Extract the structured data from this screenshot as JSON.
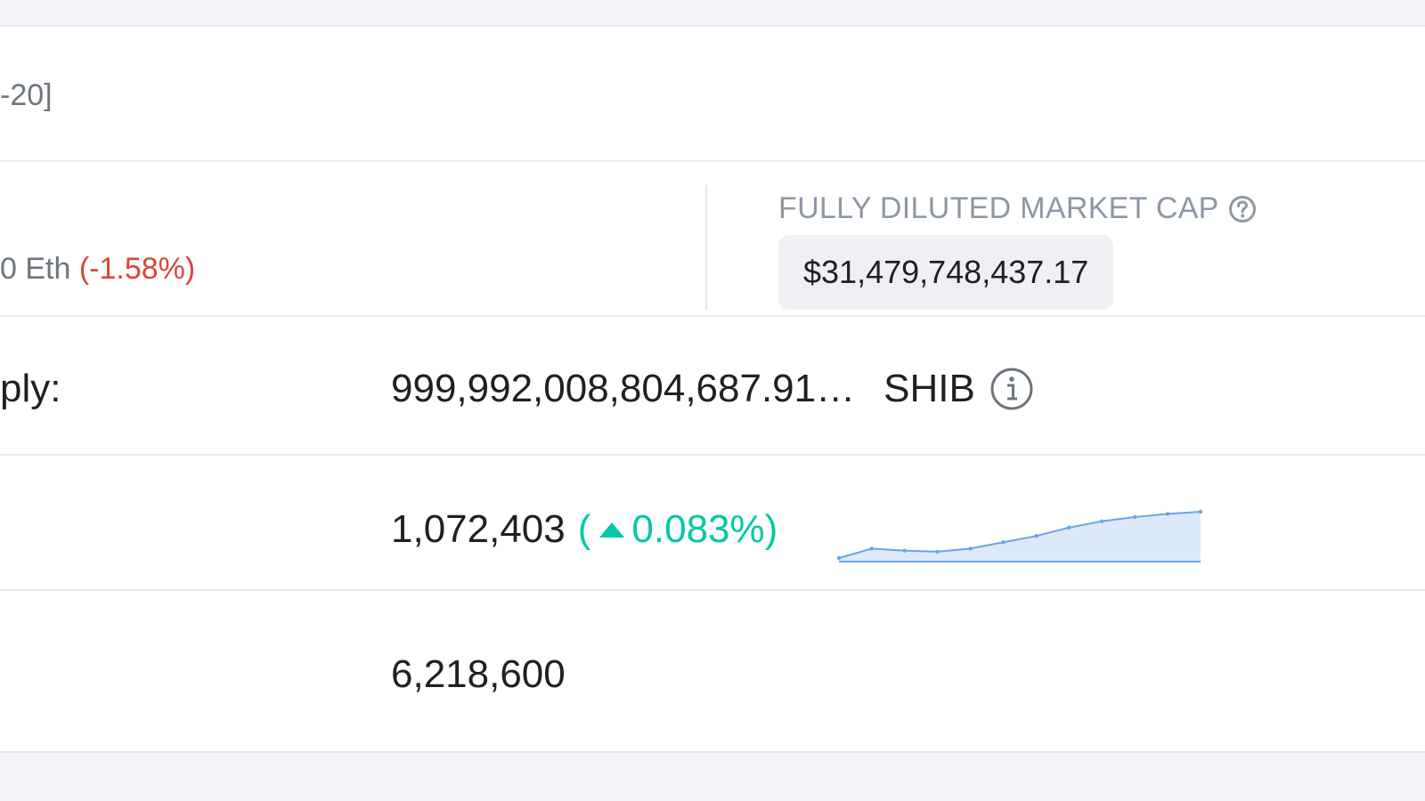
{
  "token_type": "-20]",
  "price_eth": {
    "value": "0 Eth",
    "change": "(-1.58%)"
  },
  "fully_diluted": {
    "label": "FULLY DILUTED MARKET CAP",
    "value": "$31,479,748,437.17",
    "help_icon": "question-circle-icon"
  },
  "supply": {
    "label": "ply:",
    "value": "999,992,008,804,687.91…",
    "symbol": "SHIB",
    "info_icon": "info-circle-icon"
  },
  "holders": {
    "value": "1,072,403",
    "change_open": "(",
    "change_value": "0.083%)",
    "trend_icon": "caret-up-icon",
    "sparkline": [
      1068000,
      1068900,
      1068700,
      1068600,
      1068900,
      1069500,
      1070100,
      1070900,
      1071500,
      1071900,
      1072200,
      1072403
    ]
  },
  "transfers": {
    "value": "6,218,600"
  },
  "colors": {
    "negative": "#de4437",
    "positive": "#00c9a7",
    "sparkline_line": "#6aa5e8",
    "sparkline_fill": "#dce9f8"
  }
}
